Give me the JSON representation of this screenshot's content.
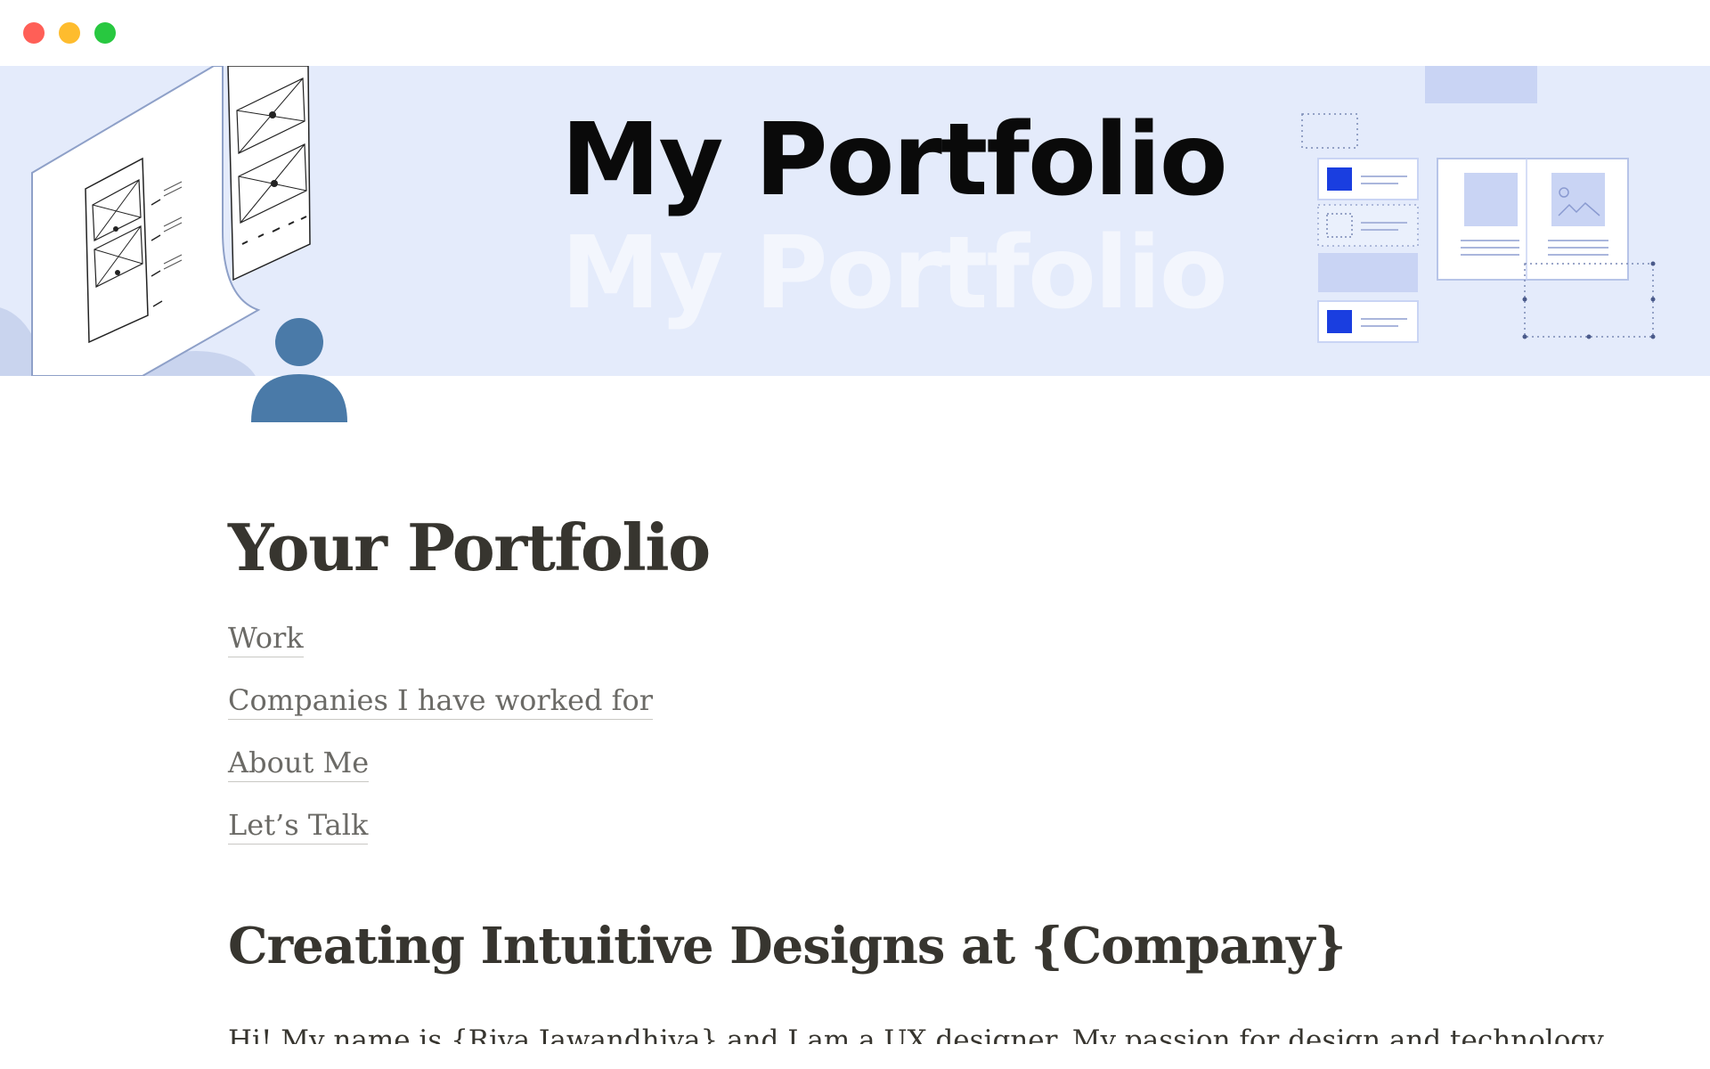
{
  "window": {
    "controls": [
      "close",
      "minimize",
      "maximize"
    ],
    "colors": {
      "close": "#ff5f57",
      "minimize": "#febc2e",
      "maximize": "#28c840"
    }
  },
  "cover": {
    "title": "My Portfolio",
    "title_echo": "My Portfolio",
    "background": "#e4ebfb",
    "accent": "#1a3ee0"
  },
  "page_icon": {
    "name": "person-icon",
    "color": "#4a7aa8"
  },
  "page": {
    "title": "Your Portfolio",
    "links": [
      {
        "label": "Work"
      },
      {
        "label": "Companies I have worked for"
      },
      {
        "label": "About Me"
      },
      {
        "label": "Let’s Talk"
      }
    ],
    "section_heading": "Creating Intuitive Designs at {Company}",
    "intro_text": "Hi! My name is {Riya Jawandhiya} and I am a UX designer. My passion for design and technology"
  }
}
